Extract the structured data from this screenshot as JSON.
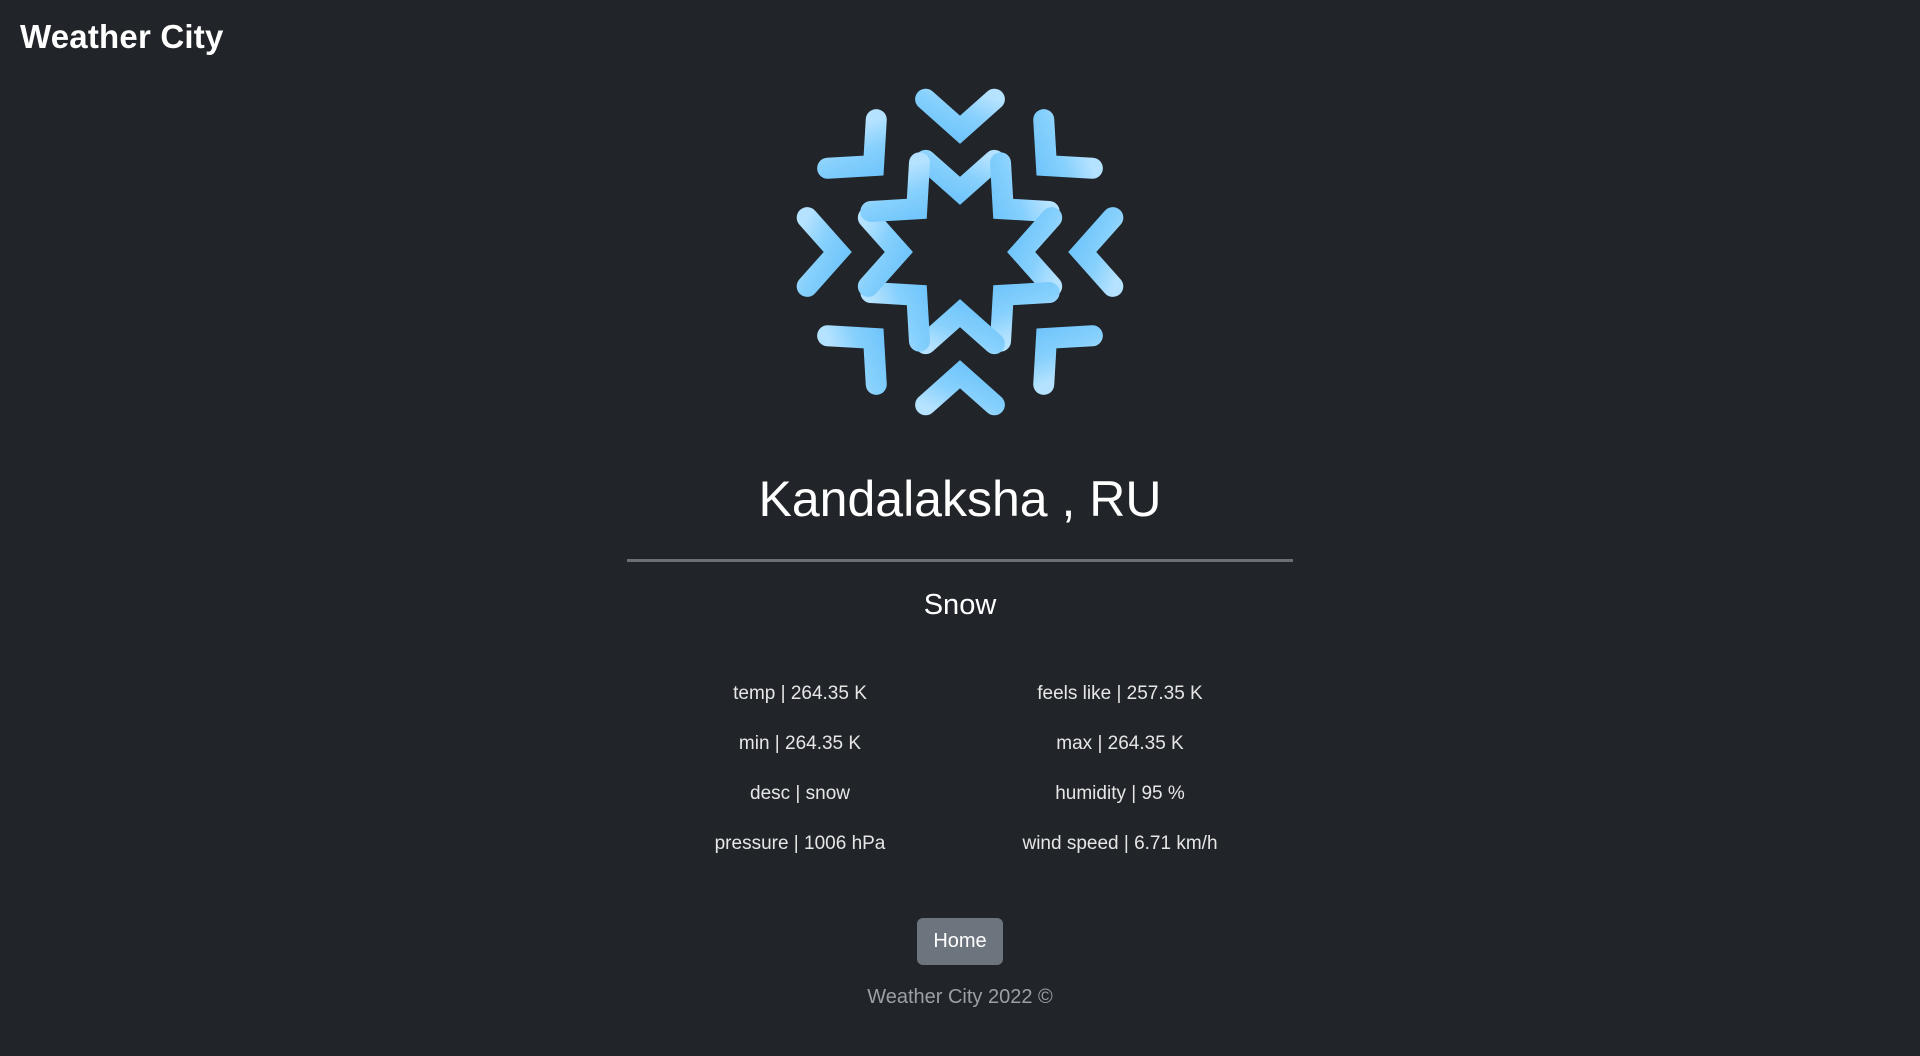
{
  "navbar": {
    "brand": "Weather City"
  },
  "weather": {
    "icon": "snowflake-icon",
    "icon_color": "#81cffc",
    "city": "Kandalaksha , RU",
    "main": "Snow",
    "stats": [
      "temp | 264.35 K",
      "feels like | 257.35 K",
      "min | 264.35 K",
      "max | 264.35 K",
      "desc | snow",
      "humidity | 95 %",
      "pressure | 1006 hPa",
      "wind speed | 6.71 km/h"
    ]
  },
  "actions": {
    "home_label": "Home",
    "home_color": "#6c757d"
  },
  "footer": {
    "text": "Weather City 2022 ©"
  },
  "colors": {
    "background": "#212529",
    "divider": "#6c6f74"
  }
}
